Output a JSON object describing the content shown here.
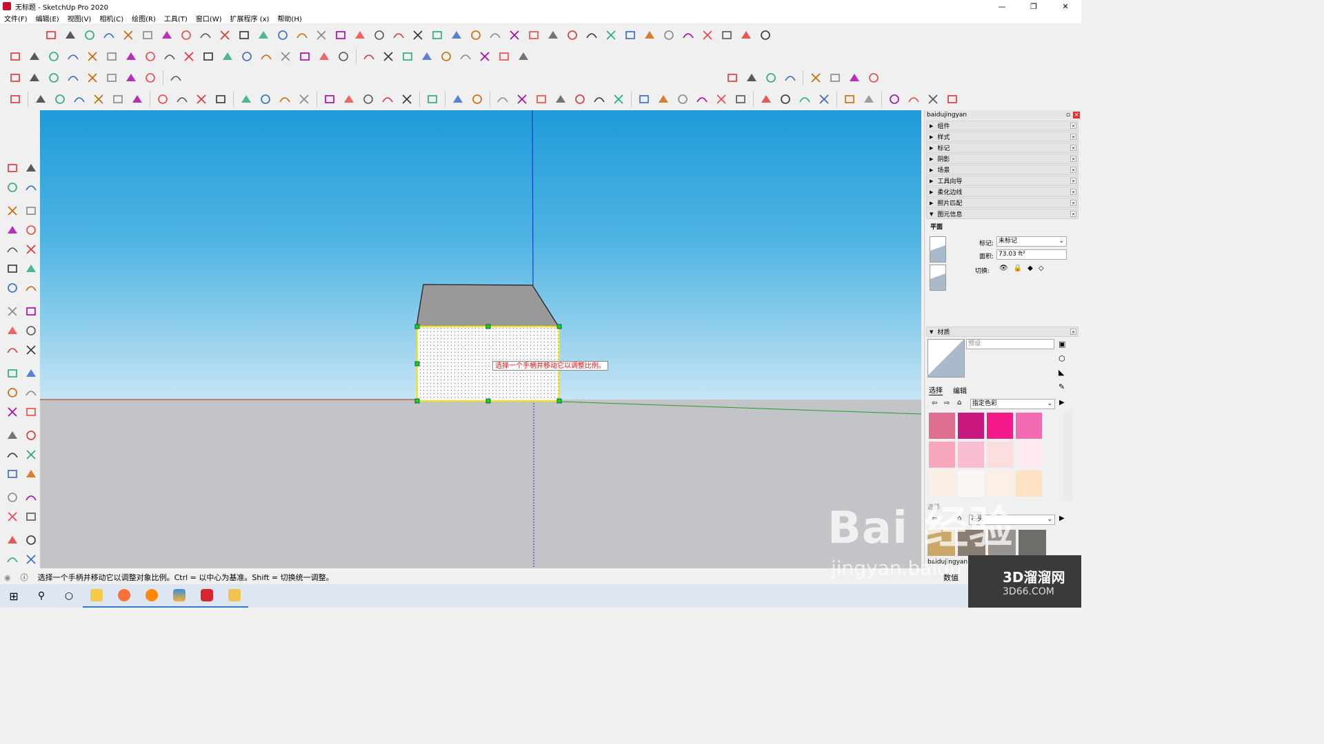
{
  "window": {
    "title": "无标题 - SketchUp Pro 2020"
  },
  "menu": [
    "文件(F)",
    "编辑(E)",
    "视图(V)",
    "相机(C)",
    "绘图(R)",
    "工具(T)",
    "窗口(W)",
    "扩展程序 (x)",
    "帮助(H)"
  ],
  "viewport": {
    "tooltip": "选择一个手柄并移动它以调整比例。",
    "colors": {
      "sky_top": "#1e9bd9",
      "sky_bottom": "#c6e5f4",
      "ground": "#c3c4c8",
      "roof": "#999999",
      "face_selected": "#fafafa",
      "handle": "#22cc22",
      "selection": "#ffee00"
    }
  },
  "right_panel": {
    "header": "baidujingyan",
    "trays": [
      {
        "label": "组件",
        "expanded": false
      },
      {
        "label": "样式",
        "expanded": false
      },
      {
        "label": "标记",
        "expanded": false
      },
      {
        "label": "阴影",
        "expanded": false
      },
      {
        "label": "场景",
        "expanded": false
      },
      {
        "label": "工具向导",
        "expanded": false
      },
      {
        "label": "柔化边线",
        "expanded": false
      },
      {
        "label": "照片匹配",
        "expanded": false
      },
      {
        "label": "图元信息",
        "expanded": true
      }
    ],
    "entity_info": {
      "type": "平面",
      "tag_label": "标记:",
      "tag_value": "未标记",
      "area_label": "面积:",
      "area_value": "73.03 ft²",
      "toggle_label": "切换:"
    },
    "materials": {
      "title": "材质",
      "name_placeholder": "预设",
      "tab_select": "选择",
      "tab_edit": "编辑",
      "library": "指定色彩",
      "swatches": [
        "#df6f90",
        "#c8177e",
        "#f51a8a",
        "#f36bb0",
        "#f8a7bd",
        "#f9bcd0",
        "#fcdde0",
        "#fdeaf0",
        "#fbefe4",
        "#fdf7f3",
        "#fcefe6",
        "#fde2c4"
      ],
      "select_label2": "选择",
      "library2": "石头",
      "footer_label": "baidujingyan",
      "tray_footer": "数值"
    }
  },
  "status": {
    "text": "选择一个手柄并移动它以调整对象比例。Ctrl = 以中心为基准。Shift = 切换统一调整。"
  },
  "watermark": {
    "brand": "Bai 经验",
    "sub": "jingyan.baidu",
    "logo_l1": "3D溜溜网",
    "logo_l2": "3D66.COM"
  }
}
